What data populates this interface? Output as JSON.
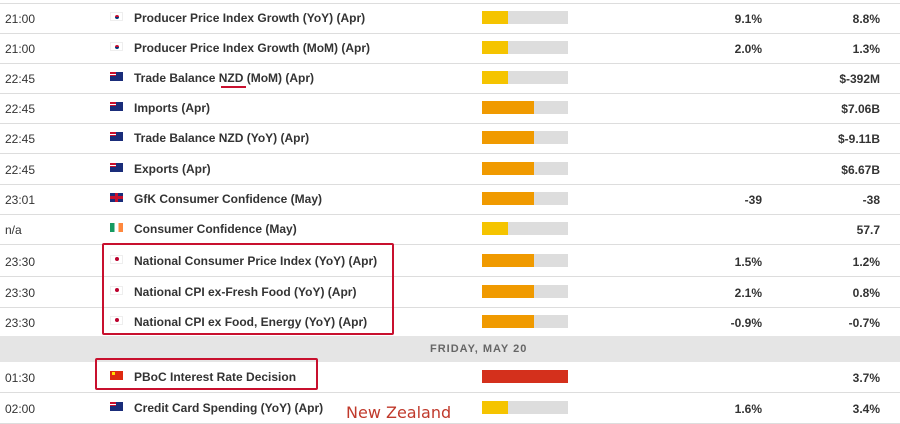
{
  "events": [
    {
      "time": "21:00",
      "country": "kr",
      "name": "Producer Price Index Growth (YoY) (Apr)",
      "impact": "low",
      "forecast": "9.1%",
      "previous": "8.8%"
    },
    {
      "time": "21:00",
      "country": "kr",
      "name": "Producer Price Index Growth (MoM) (Apr)",
      "impact": "low",
      "forecast": "2.0%",
      "previous": "1.3%"
    },
    {
      "time": "22:45",
      "country": "nz",
      "name": "Trade Balance NZD (MoM) (Apr)",
      "impact": "low",
      "forecast": "",
      "previous": "$-392M"
    },
    {
      "time": "22:45",
      "country": "nz",
      "name": "Imports (Apr)",
      "impact": "medium",
      "forecast": "",
      "previous": "$7.06B"
    },
    {
      "time": "22:45",
      "country": "nz",
      "name": "Trade Balance NZD (YoY) (Apr)",
      "impact": "medium",
      "forecast": "",
      "previous": "$-9.11B"
    },
    {
      "time": "22:45",
      "country": "nz",
      "name": "Exports (Apr)",
      "impact": "medium",
      "forecast": "",
      "previous": "$6.67B"
    },
    {
      "time": "23:01",
      "country": "gb",
      "name": "GfK Consumer Confidence (May)",
      "impact": "medium",
      "forecast": "-39",
      "previous": "-38"
    },
    {
      "time": "n/a",
      "country": "ie",
      "name": "Consumer Confidence (May)",
      "impact": "low",
      "forecast": "",
      "previous": "57.7"
    },
    {
      "time": "23:30",
      "country": "jp",
      "name": "National Consumer Price Index (YoY) (Apr)",
      "impact": "medium",
      "forecast": "1.5%",
      "previous": "1.2%"
    },
    {
      "time": "23:30",
      "country": "jp",
      "name": "National CPI ex-Fresh Food (YoY) (Apr)",
      "impact": "medium",
      "forecast": "2.1%",
      "previous": "0.8%"
    },
    {
      "time": "23:30",
      "country": "jp",
      "name": "National CPI ex Food, Energy (YoY) (Apr)",
      "impact": "medium",
      "forecast": "-0.9%",
      "previous": "-0.7%"
    },
    {
      "time": "01:30",
      "country": "cn",
      "name": "PBoC Interest Rate Decision",
      "impact": "high",
      "forecast": "",
      "previous": "3.7%"
    },
    {
      "time": "02:00",
      "country": "nz",
      "name": "Credit Card Spending (YoY) (Apr)",
      "impact": "low",
      "forecast": "1.6%",
      "previous": "3.4%"
    }
  ],
  "day_separator": "FRIDAY, MAY 20",
  "annotation": "New Zealand",
  "impact_levels": {
    "low": 0.3,
    "medium": 0.6,
    "high": 1.0
  },
  "colors": {
    "low": "#f5c400",
    "medium": "#f09a00",
    "high": "#d4301c",
    "annotation": "#c8102e"
  }
}
